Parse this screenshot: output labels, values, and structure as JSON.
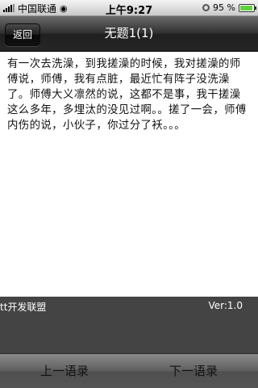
{
  "status_bar": {
    "carrier": "中国联通",
    "time": "上午9:27",
    "battery_percent": "95 %",
    "battery_level": 0.95,
    "icons": [
      "signal-icon",
      "wifi-icon",
      "orientation-lock-icon",
      "battery-icon"
    ]
  },
  "nav": {
    "back_label": "返回",
    "title": "无题1(1)"
  },
  "content": {
    "text": "有一次去洗澡，到我搓澡的时候，我对搓澡的师傅说，师傅，我有点脏，最近忙有阵子没洗澡了。师傅大义凛然的说，这都不是事，我干搓澡这么多年，多埋汰的没见过啊。。搓了一会，师傅内伤的说，小伙子，你过分了袄。。。"
  },
  "info_bar": {
    "left": "tt开发联盟",
    "right": "Ver:1.0"
  },
  "toolbar": {
    "prev_label": "上一语录",
    "next_label": "下一语录"
  },
  "colors": {
    "nav_bar": "#2e2e2e",
    "info_bar": "#444444",
    "toolbar": "#6a6a6a",
    "battery_fill": "#5fd23c"
  }
}
